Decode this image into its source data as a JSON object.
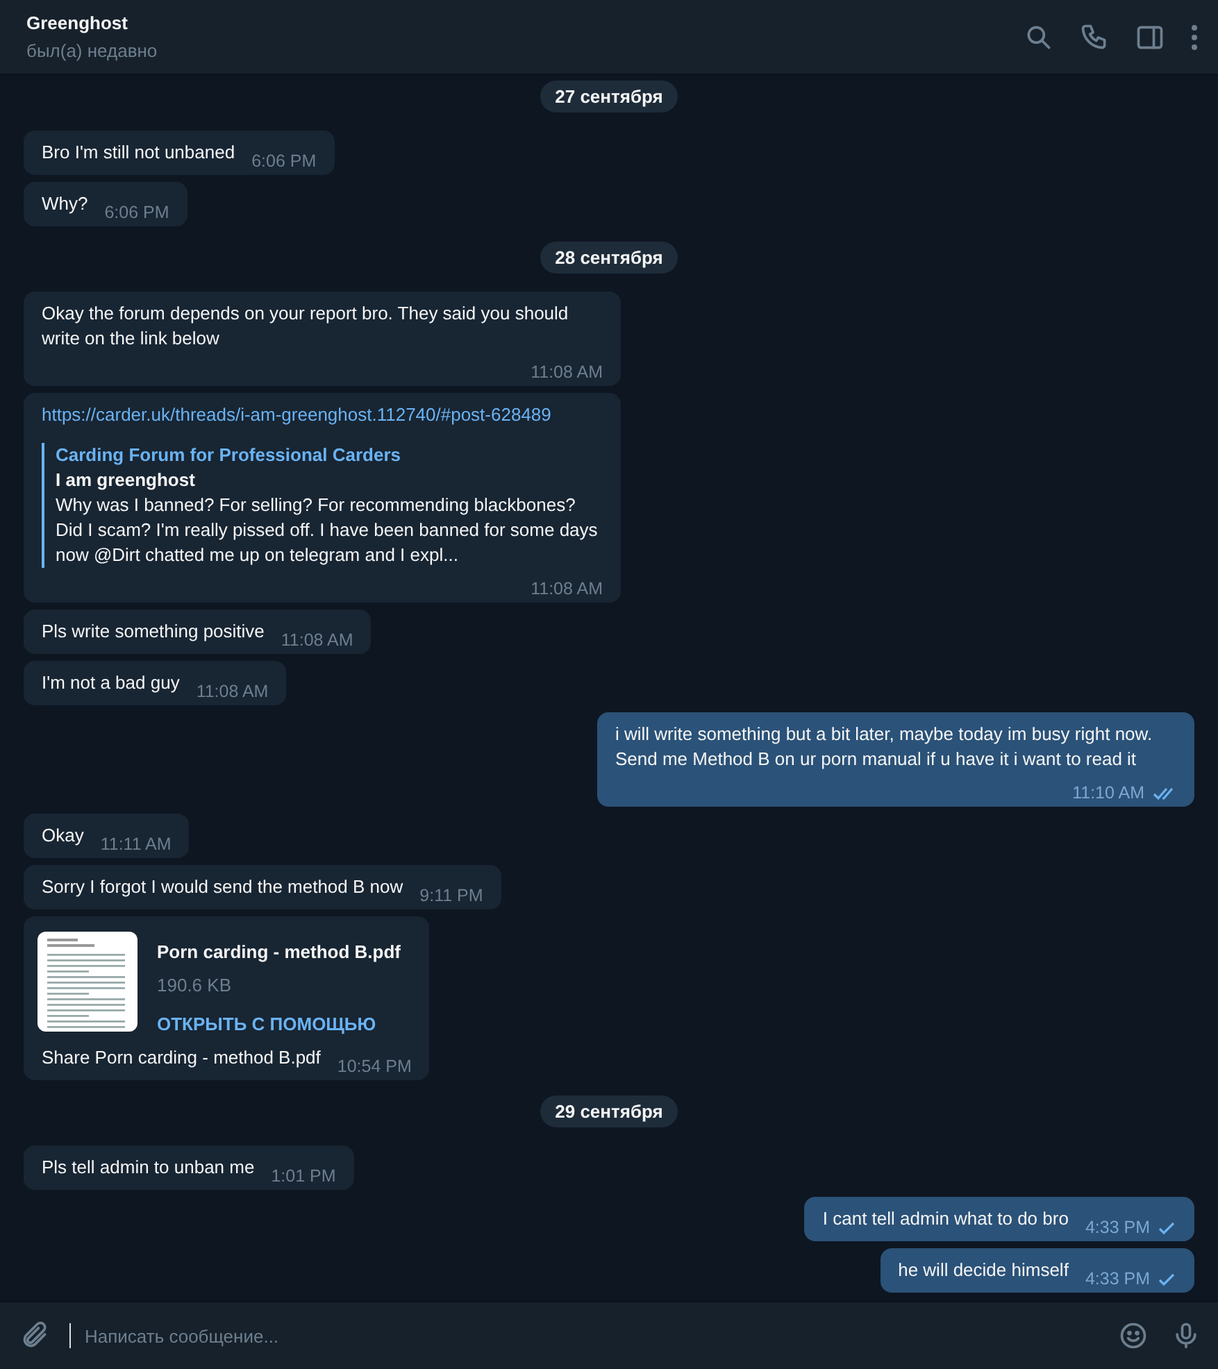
{
  "header": {
    "name": "Greenghost",
    "status": "был(а) недавно"
  },
  "messages": [
    {
      "kind": "date",
      "text": "27 сентября"
    },
    {
      "kind": "text",
      "outgoing": false,
      "text": "Bro I'm still not unbaned",
      "time": "6:06 PM"
    },
    {
      "kind": "text",
      "outgoing": false,
      "text": "Why?",
      "time": "6:06 PM"
    },
    {
      "kind": "date",
      "text": "28 сентября"
    },
    {
      "kind": "text",
      "outgoing": false,
      "text": "Okay the forum depends on your report bro. They said you should write on the link below",
      "time": "11:08 AM"
    },
    {
      "kind": "link",
      "outgoing": false,
      "url": "https://carder.uk/threads/i-am-greenghost.112740/#post-628489",
      "site": "Carding Forum for Professional Carders",
      "title": "I am greenghost",
      "description": "Why was I banned? For selling? For recommending blackbones? Did I scam? I'm really pissed off. I have been banned for some days now @Dirt chatted me up on telegram and I expl...",
      "time": "11:08 AM"
    },
    {
      "kind": "text",
      "outgoing": false,
      "text": "Pls write something positive",
      "time": "11:08 AM"
    },
    {
      "kind": "text",
      "outgoing": false,
      "text": "I'm not a bad guy",
      "time": "11:08 AM"
    },
    {
      "kind": "text",
      "outgoing": true,
      "read": true,
      "text": "i will write something but a bit later, maybe today im busy right now. Send me Method B on ur porn manual if u have it i want to read it",
      "time": "11:10 AM"
    },
    {
      "kind": "text",
      "outgoing": false,
      "text": "Okay",
      "time": "11:11 AM"
    },
    {
      "kind": "text",
      "outgoing": false,
      "text": "Sorry I forgot I would send the method B now",
      "time": "9:11 PM"
    },
    {
      "kind": "file",
      "outgoing": false,
      "filename": "Porn carding - method B.pdf",
      "size": "190.6 KB",
      "action": "ОТКРЫТЬ С ПОМОЩЬЮ",
      "caption": "Share Porn carding - method B.pdf",
      "time": "10:54 PM"
    },
    {
      "kind": "date",
      "text": "29 сентября"
    },
    {
      "kind": "text",
      "outgoing": false,
      "text": "Pls tell admin to unban me",
      "time": "1:01 PM"
    },
    {
      "kind": "text",
      "outgoing": true,
      "read": false,
      "text": "I cant tell admin what to do bro",
      "time": "4:33 PM"
    },
    {
      "kind": "text",
      "outgoing": true,
      "read": false,
      "text": "he will decide himself",
      "time": "4:33 PM"
    }
  ],
  "composer": {
    "placeholder": "Написать сообщение..."
  }
}
